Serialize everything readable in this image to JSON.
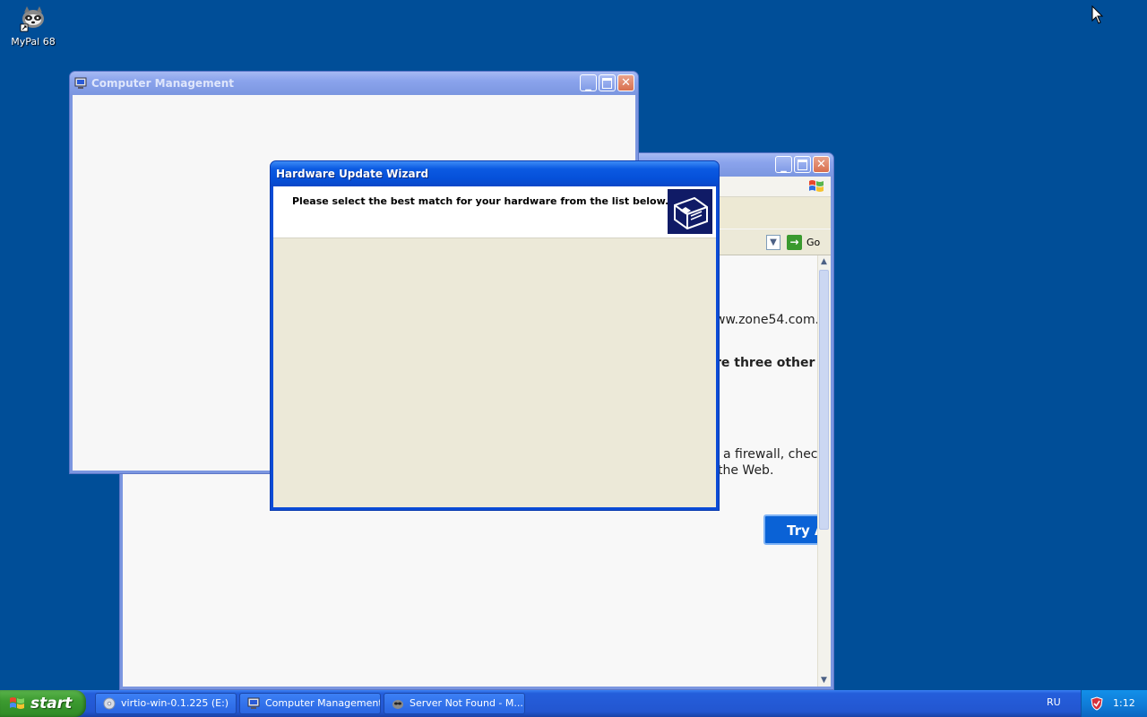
{
  "desktop": {
    "icons": [
      {
        "label": "MyPal 68",
        "icon": "raccoon-icon"
      }
    ]
  },
  "windows": {
    "computer_management": {
      "title": "Computer Management",
      "icon": "computer-management-icon"
    },
    "browser": {
      "title": "Server Not Found - M...",
      "address_go_label": "Go",
      "content_lines": [
        "ww.zone54.com.",
        "re three other",
        "a firewall, check",
        "the Web."
      ],
      "try_again_label": "Try A"
    },
    "wizard": {
      "title": "Hardware Update Wizard",
      "instruction": "Please select the best match for your hardware from the list below.",
      "icon": "hardware-icon"
    }
  },
  "taskbar": {
    "start_label": "start",
    "buttons": [
      {
        "label": "virtio-win-0.1.225 (E:)",
        "icon": "cd-drive-icon"
      },
      {
        "label": "Computer Management",
        "icon": "computer-management-icon"
      },
      {
        "label": "Server Not Found - M...",
        "icon": "browser-icon"
      }
    ],
    "language": "RU",
    "clock": "1:12"
  },
  "colors": {
    "desktop": "#004e98",
    "active_title": "#0550d9",
    "inactive_title": "#7b96e0",
    "start_green": "#3c9a30"
  }
}
